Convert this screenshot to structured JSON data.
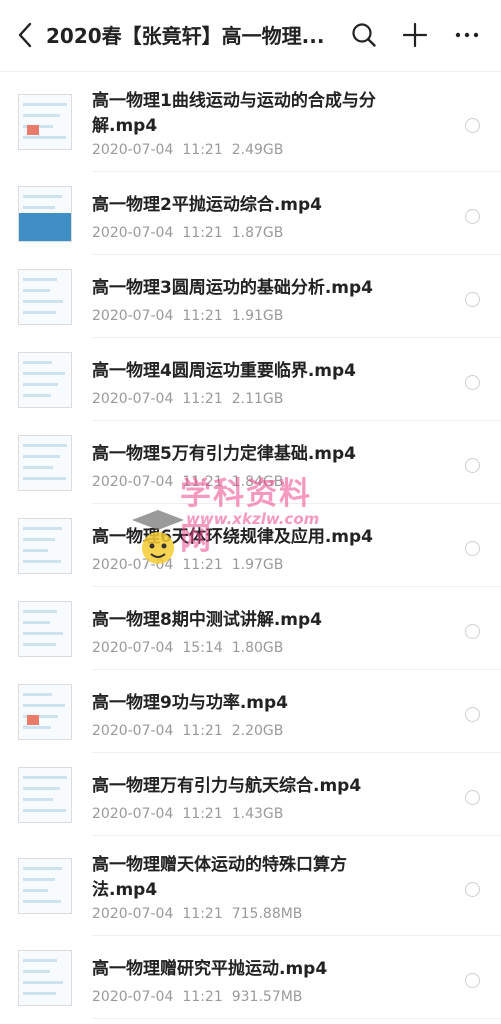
{
  "header": {
    "title": "2020春【张竟轩】高一物理...",
    "icons": {
      "back": "back-arrow-icon",
      "search": "search-icon",
      "add": "plus-icon",
      "more": "more-dots-icon"
    }
  },
  "files": [
    {
      "name_line1": "高一物理1曲线运动与运动的合成与分",
      "name_line2": "解.mp4",
      "date": "2020-07-04",
      "time": "11:21",
      "size": "2.49GB"
    },
    {
      "name_line1": "高一物理2平抛运动综合.mp4",
      "date": "2020-07-04",
      "time": "11:21",
      "size": "1.87GB"
    },
    {
      "name_line1": "高一物理3圆周运功的基础分析.mp4",
      "date": "2020-07-04",
      "time": "11:21",
      "size": "1.91GB"
    },
    {
      "name_line1": "高一物理4圆周运功重要临界.mp4",
      "date": "2020-07-04",
      "time": "11:21",
      "size": "2.11GB"
    },
    {
      "name_line1": "高一物理5万有引力定律基础.mp4",
      "date": "2020-07-04",
      "time": "11:21",
      "size": "1.84GB"
    },
    {
      "name_line1": "高一物理6天体环绕规律及应用.mp4",
      "date": "2020-07-04",
      "time": "11:21",
      "size": "1.97GB"
    },
    {
      "name_line1": "高一物理8期中测试讲解.mp4",
      "date": "2020-07-04",
      "time": "15:14",
      "size": "1.80GB"
    },
    {
      "name_line1": "高一物理9功与功率.mp4",
      "date": "2020-07-04",
      "time": "11:21",
      "size": "2.20GB"
    },
    {
      "name_line1": "高一物理万有引力与航天综合.mp4",
      "date": "2020-07-04",
      "time": "11:21",
      "size": "1.43GB"
    },
    {
      "name_line1": "高一物理赠天体运动的特殊口算方",
      "name_line2": "法.mp4",
      "date": "2020-07-04",
      "time": "11:21",
      "size": "715.88MB"
    },
    {
      "name_line1": "高一物理赠研究平抛运动.mp4",
      "date": "2020-07-04",
      "time": "11:21",
      "size": "931.57MB"
    }
  ],
  "watermark": {
    "text": "学科资料网",
    "url": "www.xkzlw.com"
  },
  "colors": {
    "text": "#222222",
    "meta": "#9a9a9a",
    "divider": "#eeeeee",
    "watermark": "#ec468c"
  }
}
